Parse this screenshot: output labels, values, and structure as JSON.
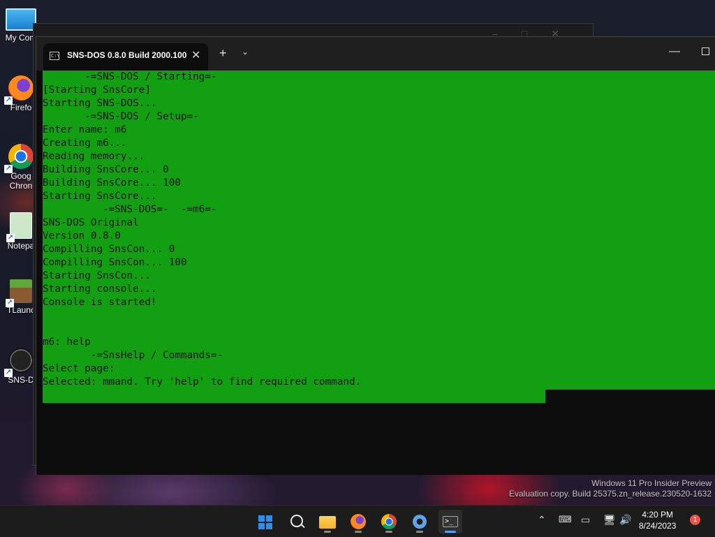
{
  "desktop": {
    "icons": [
      {
        "label": "My Com",
        "icon": "monitor-icon"
      },
      {
        "label": "Firefo",
        "icon": "firefox-icon"
      },
      {
        "label": "Goog Chron",
        "icon": "chrome-icon"
      },
      {
        "label": "Notepa",
        "icon": "notepad-icon"
      },
      {
        "label": "TLaunc",
        "icon": "minecraft-icon"
      },
      {
        "label": "SNS-D",
        "icon": "sns-dos-icon"
      }
    ]
  },
  "terminal": {
    "tab_title": "SNS-DOS 0.8.0 Build 2000.100",
    "console_lines": [
      "       -=SNS-DOS / Starting=-",
      "[Starting SnsCore]",
      "Starting SNS-DOS...",
      "       -=SNS-DOS / Setup=-",
      "Enter name: m6",
      "Creating m6...",
      "Reading memory...",
      "Building SnsCore... 0",
      "Building SnsCore... 100",
      "Starting SnsCore...",
      "          -=SNS-DOS=-  -=m6=-",
      "SNS-DOS Original",
      "Version 0.8.0",
      "Compilling SnsCon... 0",
      "Compilling SnsCon... 100",
      "Starting SnsCon...",
      "Starting console...",
      "Console is started!",
      "",
      "",
      "m6: help",
      "        -=SnsHelp / Commands=-",
      "Select page:",
      "Selected: mmand. Try 'help' to find required command."
    ],
    "console_bg": "#12a012",
    "console_fg": "#051405"
  },
  "watermark": {
    "line1": "Windows 11 Pro Insider Preview",
    "line2": "Evaluation copy. Build 25375.zn_release.230520-1632"
  },
  "taskbar": {
    "apps": [
      "start-icon",
      "search-icon",
      "file-explorer-icon",
      "firefox-icon",
      "chrome-icon",
      "settings-icon",
      "terminal-icon"
    ],
    "time": "4:20 PM",
    "date": "8/24/2023",
    "notification_count": "1"
  }
}
